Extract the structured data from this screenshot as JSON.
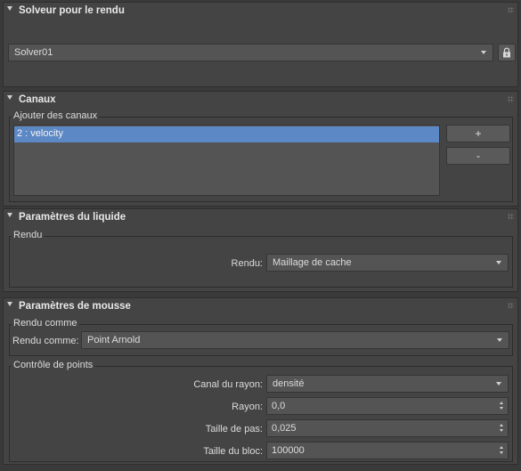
{
  "solver": {
    "title": "Solveur pour le rendu",
    "value": "Solver01",
    "lock_icon": "lock-icon"
  },
  "channels": {
    "title": "Canaux",
    "group_label": "Ajouter des canaux",
    "items": [
      {
        "label": "2 : velocity",
        "selected": true
      }
    ],
    "add_label": "+",
    "remove_label": "-"
  },
  "liquid": {
    "title": "Paramètres du liquide",
    "group_label": "Rendu",
    "render_label": "Rendu:",
    "render_value": "Maillage de cache"
  },
  "foam": {
    "title": "Paramètres de mousse",
    "render_as_group": "Rendu comme",
    "render_as_label": "Rendu comme:",
    "render_as_value": "Point Arnold",
    "points_group": "Contrôle de points",
    "radius_channel_label": "Canal du rayon:",
    "radius_channel_value": "densité",
    "radius_label": "Rayon:",
    "radius_value": "0,0",
    "step_label": "Taille de pas:",
    "step_value": "0,025",
    "block_label": "Taille du bloc:",
    "block_value": "100000"
  }
}
